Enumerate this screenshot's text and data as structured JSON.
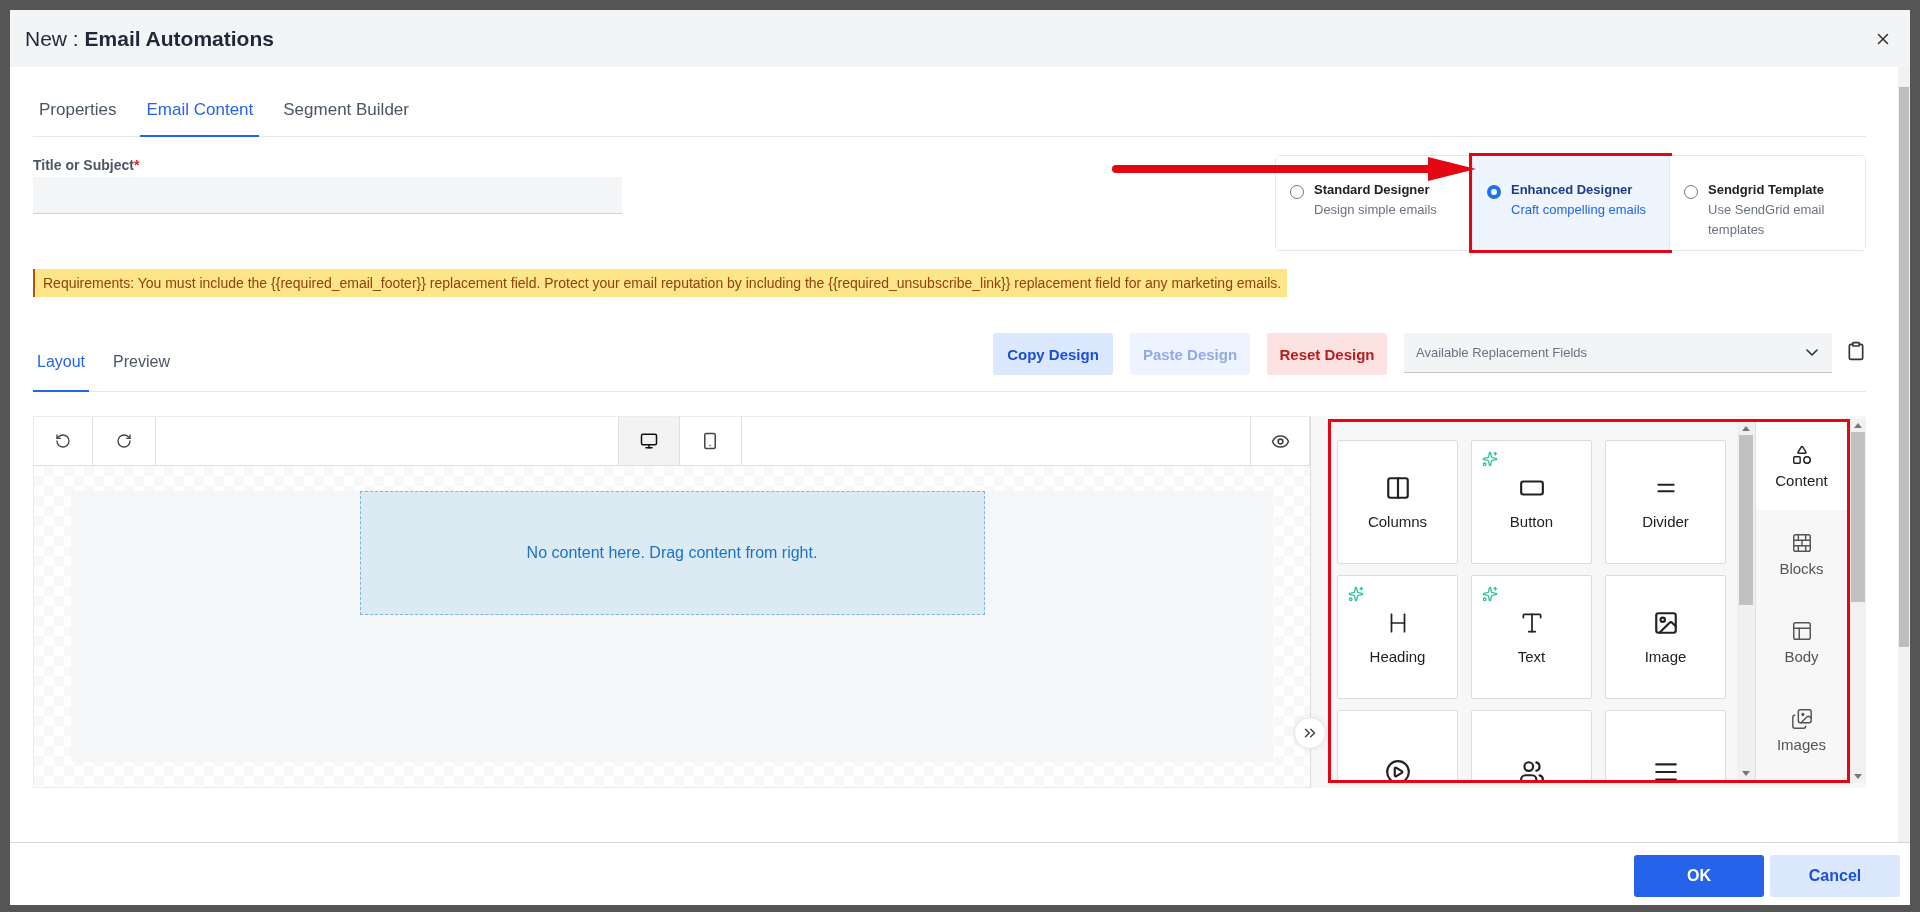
{
  "window": {
    "title_prefix": "New :",
    "title": "Email Automations"
  },
  "tabs": [
    {
      "label": "Properties",
      "selected": false
    },
    {
      "label": "Email Content",
      "selected": true
    },
    {
      "label": "Segment Builder",
      "selected": false
    }
  ],
  "subject_field": {
    "label": "Title or Subject",
    "required_mark": "*"
  },
  "designer_options": [
    {
      "title": "Standard Designer",
      "description": "Design simple emails",
      "selected": false,
      "highlighted": false
    },
    {
      "title": "Enhanced Designer",
      "description": "Craft compelling emails",
      "selected": true,
      "highlighted": true
    },
    {
      "title": "Sendgrid Template",
      "description": "Use SendGrid email templates",
      "selected": false,
      "highlighted": false
    }
  ],
  "pointer_arrow": true,
  "requirements_banner": "Requirements: You must include the {{required_email_footer}} replacement field. Protect your email reputation by including the {{required_unsubscribe_link}} replacement field for any marketing emails.",
  "editor_tabs": [
    {
      "label": "Layout",
      "selected": true
    },
    {
      "label": "Preview",
      "selected": false
    }
  ],
  "actions": [
    {
      "label": "Copy Design",
      "kind": "primary",
      "disabled": false
    },
    {
      "label": "Paste Design",
      "kind": "primary",
      "disabled": true
    },
    {
      "label": "Reset Design",
      "kind": "danger",
      "disabled": false
    }
  ],
  "replacement_fields": {
    "placeholder": "Available Replacement Fields"
  },
  "editor_toolbar": {
    "views": [
      {
        "kind": "desktop",
        "selected": true
      },
      {
        "kind": "mobile",
        "selected": false
      }
    ]
  },
  "canvas": {
    "empty_message": "No content here. Drag content from right."
  },
  "content_panel": {
    "highlighted": true,
    "tiles": [
      {
        "label": "Columns",
        "ai": false
      },
      {
        "label": "Button",
        "ai": true
      },
      {
        "label": "Divider",
        "ai": false
      },
      {
        "label": "Heading",
        "ai": true
      },
      {
        "label": "Text",
        "ai": true
      },
      {
        "label": "Image",
        "ai": false
      },
      {
        "ai": false
      },
      {
        "ai": false
      },
      {
        "ai": false
      }
    ],
    "side_tabs": [
      {
        "label": "Content",
        "selected": true
      },
      {
        "label": "Blocks",
        "selected": false
      },
      {
        "label": "Body",
        "selected": false
      },
      {
        "label": "Images",
        "selected": false
      }
    ]
  },
  "footer_buttons": [
    {
      "label": "OK",
      "kind": "primary"
    },
    {
      "label": "Cancel",
      "kind": "secondary"
    }
  ]
}
